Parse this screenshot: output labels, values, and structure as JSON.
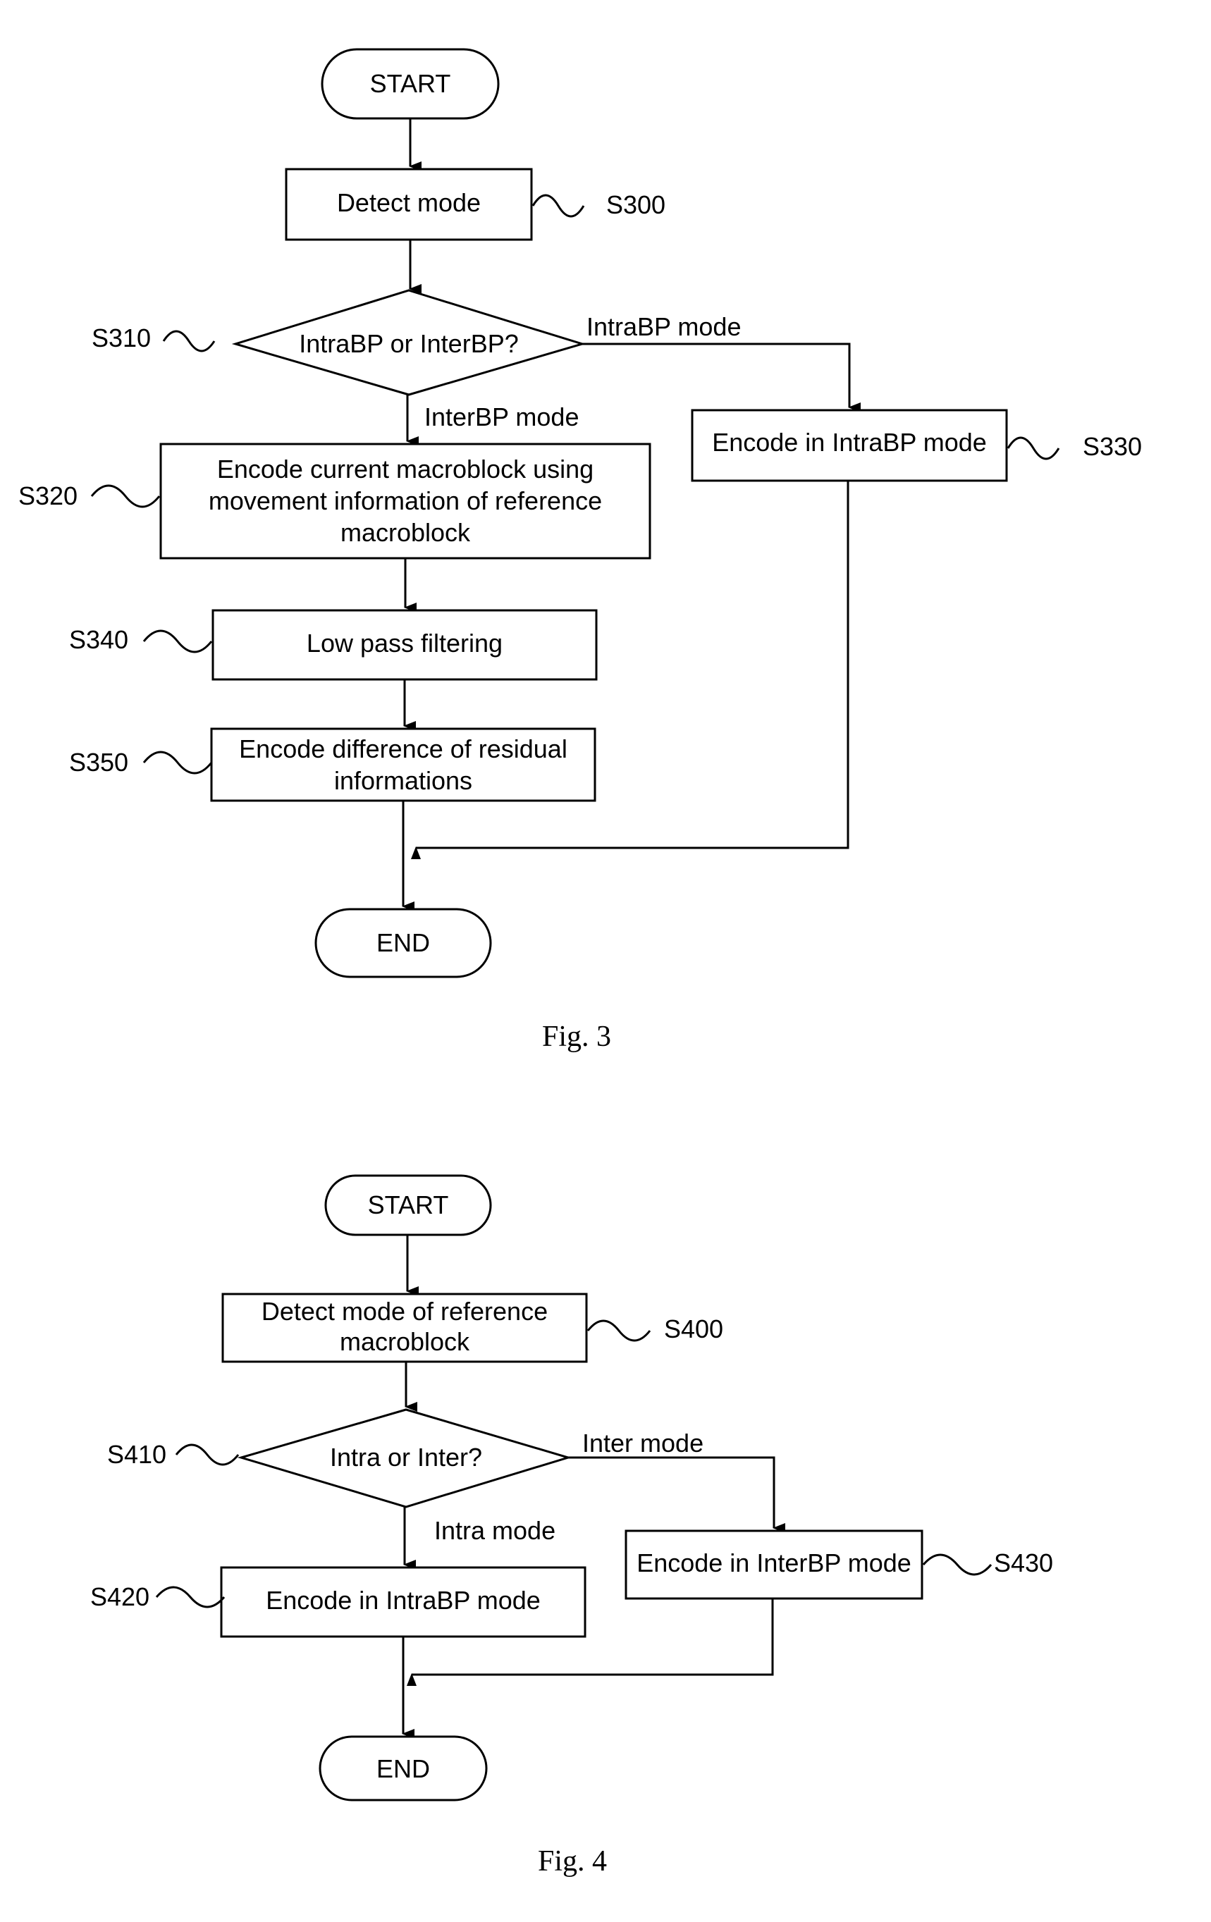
{
  "fig3": {
    "caption": "Fig. 3",
    "start": "START",
    "end": "END",
    "s300": {
      "ref": "S300",
      "lines": [
        "Detect mode"
      ]
    },
    "s310": {
      "ref": "S310",
      "lines": [
        "IntraBP or InterBP?"
      ],
      "yes_label": "IntraBP mode",
      "no_label": "InterBP mode"
    },
    "s320": {
      "ref": "S320",
      "lines": [
        "Encode current macroblock using",
        "movement information of reference",
        "macroblock"
      ]
    },
    "s330": {
      "ref": "S330",
      "lines": [
        "Encode in IntraBP mode"
      ]
    },
    "s340": {
      "ref": "S340",
      "lines": [
        "Low pass filtering"
      ]
    },
    "s350": {
      "ref": "S350",
      "lines": [
        "Encode difference of residual",
        "informations"
      ]
    }
  },
  "fig4": {
    "caption": "Fig. 4",
    "start": "START",
    "end": "END",
    "s400": {
      "ref": "S400",
      "lines": [
        "Detect mode of reference",
        "macroblock"
      ]
    },
    "s410": {
      "ref": "S410",
      "lines": [
        "Intra or Inter?"
      ],
      "right_label": "Inter mode",
      "down_label": "Intra mode"
    },
    "s420": {
      "ref": "S420",
      "lines": [
        "Encode in IntraBP mode"
      ]
    },
    "s430": {
      "ref": "S430",
      "lines": [
        "Encode in InterBP mode"
      ]
    }
  }
}
